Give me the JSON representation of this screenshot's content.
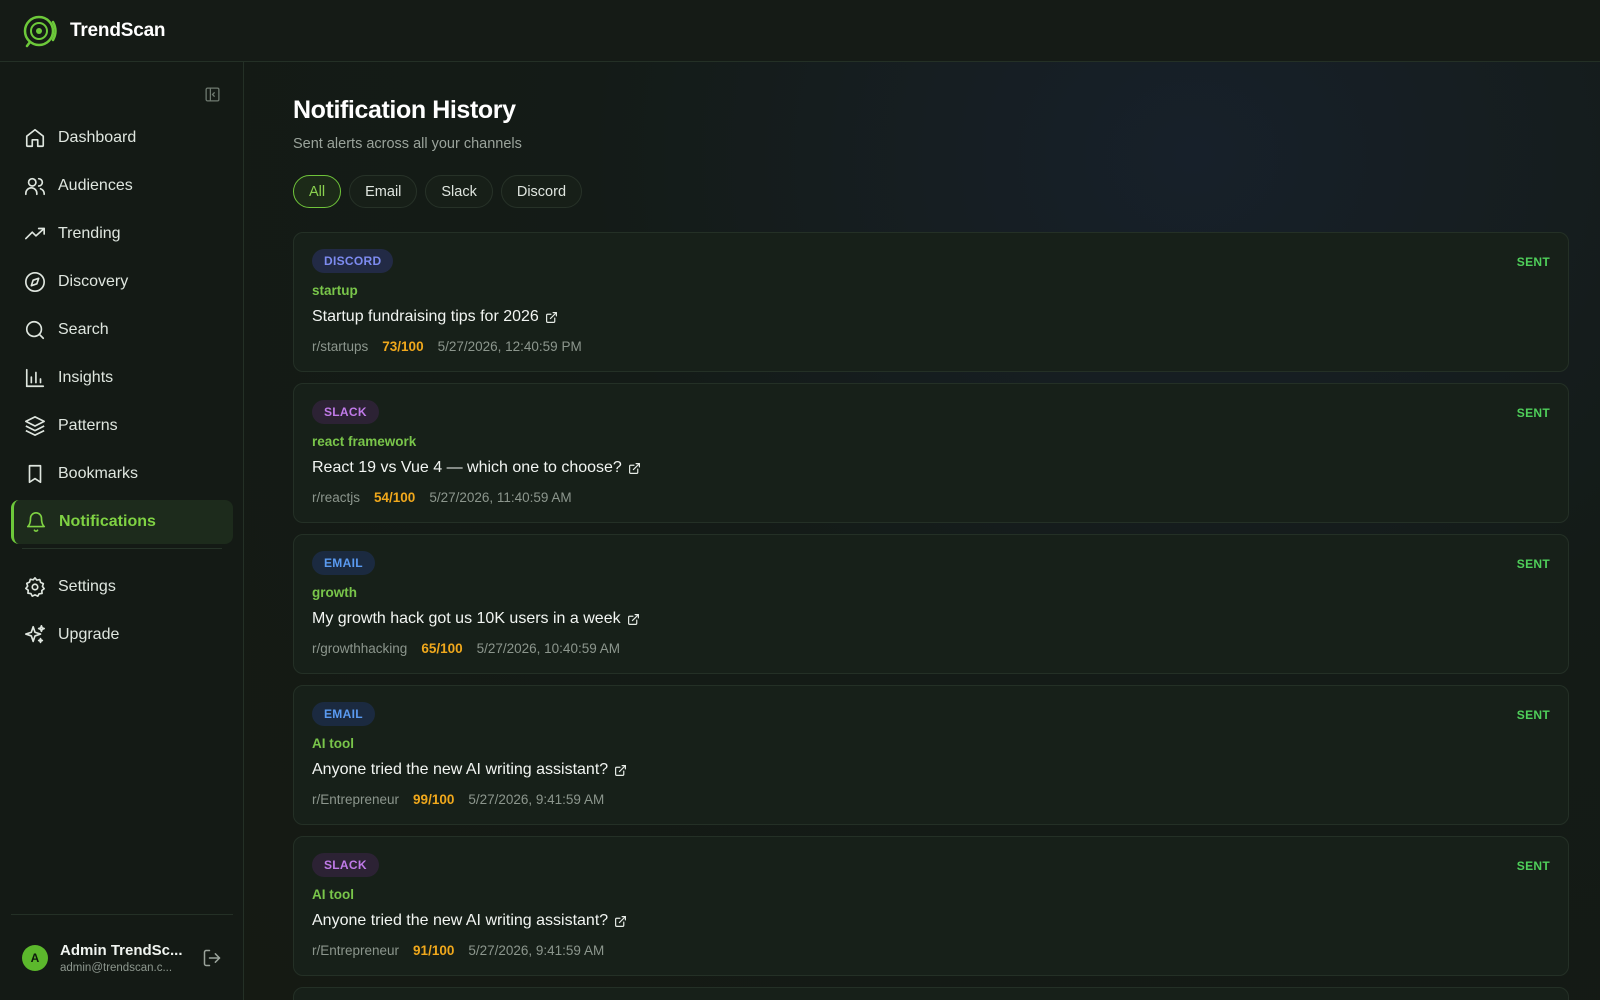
{
  "app": {
    "brand": "TrendScan"
  },
  "sidebar": {
    "items": [
      {
        "label": "Dashboard",
        "icon": "home-icon",
        "active": false
      },
      {
        "label": "Audiences",
        "icon": "users-icon",
        "active": false
      },
      {
        "label": "Trending",
        "icon": "trending-up-icon",
        "active": false
      },
      {
        "label": "Discovery",
        "icon": "compass-icon",
        "active": false
      },
      {
        "label": "Search",
        "icon": "search-icon",
        "active": false
      },
      {
        "label": "Insights",
        "icon": "bar-chart-icon",
        "active": false
      },
      {
        "label": "Patterns",
        "icon": "layers-icon",
        "active": false
      },
      {
        "label": "Bookmarks",
        "icon": "bookmark-icon",
        "active": false
      },
      {
        "label": "Notifications",
        "icon": "bell-icon",
        "active": true
      }
    ],
    "secondary": [
      {
        "label": "Settings",
        "icon": "gear-icon"
      },
      {
        "label": "Upgrade",
        "icon": "sparkles-icon"
      }
    ],
    "user": {
      "initial": "A",
      "name": "Admin TrendSc...",
      "email": "admin@trendscan.c..."
    }
  },
  "page": {
    "title": "Notification History",
    "subtitle": "Sent alerts across all your channels"
  },
  "filters": [
    {
      "label": "All",
      "active": true
    },
    {
      "label": "Email",
      "active": false
    },
    {
      "label": "Slack",
      "active": false
    },
    {
      "label": "Discord",
      "active": false
    }
  ],
  "notifications": [
    {
      "channel": "DISCORD",
      "status": "SENT",
      "keyword": "startup",
      "title": "Startup fundraising tips for 2026",
      "subreddit": "r/startups",
      "score": "73/100",
      "timestamp": "5/27/2026, 12:40:59 PM"
    },
    {
      "channel": "SLACK",
      "status": "SENT",
      "keyword": "react framework",
      "title": "React 19 vs Vue 4 — which one to choose?",
      "subreddit": "r/reactjs",
      "score": "54/100",
      "timestamp": "5/27/2026, 11:40:59 AM"
    },
    {
      "channel": "EMAIL",
      "status": "SENT",
      "keyword": "growth",
      "title": "My growth hack got us 10K users in a week",
      "subreddit": "r/growthhacking",
      "score": "65/100",
      "timestamp": "5/27/2026, 10:40:59 AM"
    },
    {
      "channel": "EMAIL",
      "status": "SENT",
      "keyword": "AI tool",
      "title": "Anyone tried the new AI writing assistant?",
      "subreddit": "r/Entrepreneur",
      "score": "99/100",
      "timestamp": "5/27/2026, 9:41:59 AM"
    },
    {
      "channel": "SLACK",
      "status": "SENT",
      "keyword": "AI tool",
      "title": "Anyone tried the new AI writing assistant?",
      "subreddit": "r/Entrepreneur",
      "score": "91/100",
      "timestamp": "5/27/2026, 9:41:59 AM"
    }
  ],
  "colors": {
    "accent": "#7fd243",
    "score": "#f0a81c",
    "sent": "#4fcf5a",
    "discord": "#7d8bf0",
    "slack": "#c07ae8",
    "email": "#5a9af0"
  }
}
